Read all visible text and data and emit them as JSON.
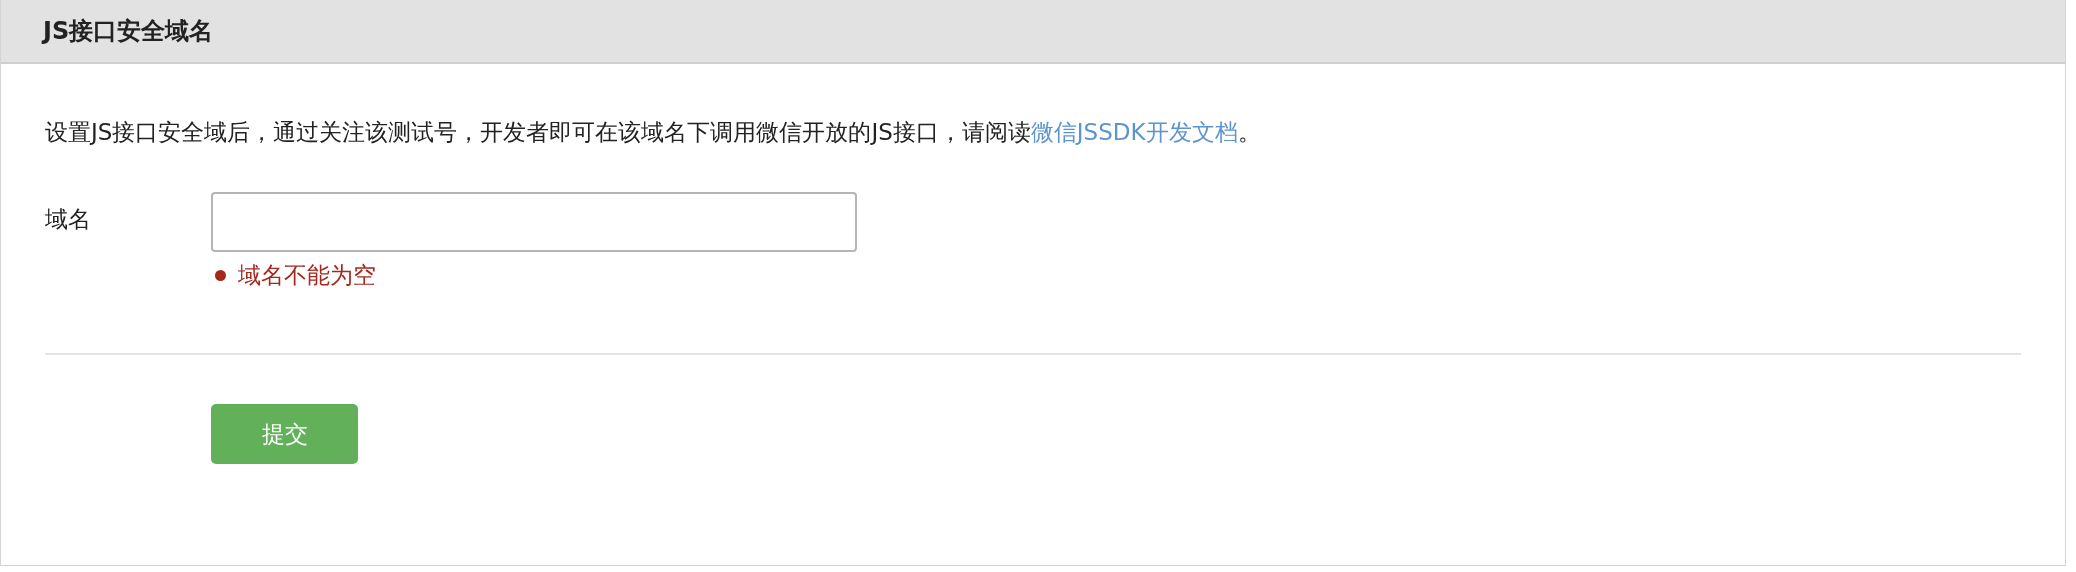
{
  "panel": {
    "title": "JS接口安全域名"
  },
  "description": {
    "text": "设置JS接口安全域后，通过关注该测试号，开发者即可在该域名下调用微信开放的JS接口，请阅读",
    "link": "微信JSSDK开发文档",
    "text_after": "。"
  },
  "field": {
    "label": "域名",
    "error": "域名不能为空"
  },
  "buttons": [
    "提交"
  ]
}
